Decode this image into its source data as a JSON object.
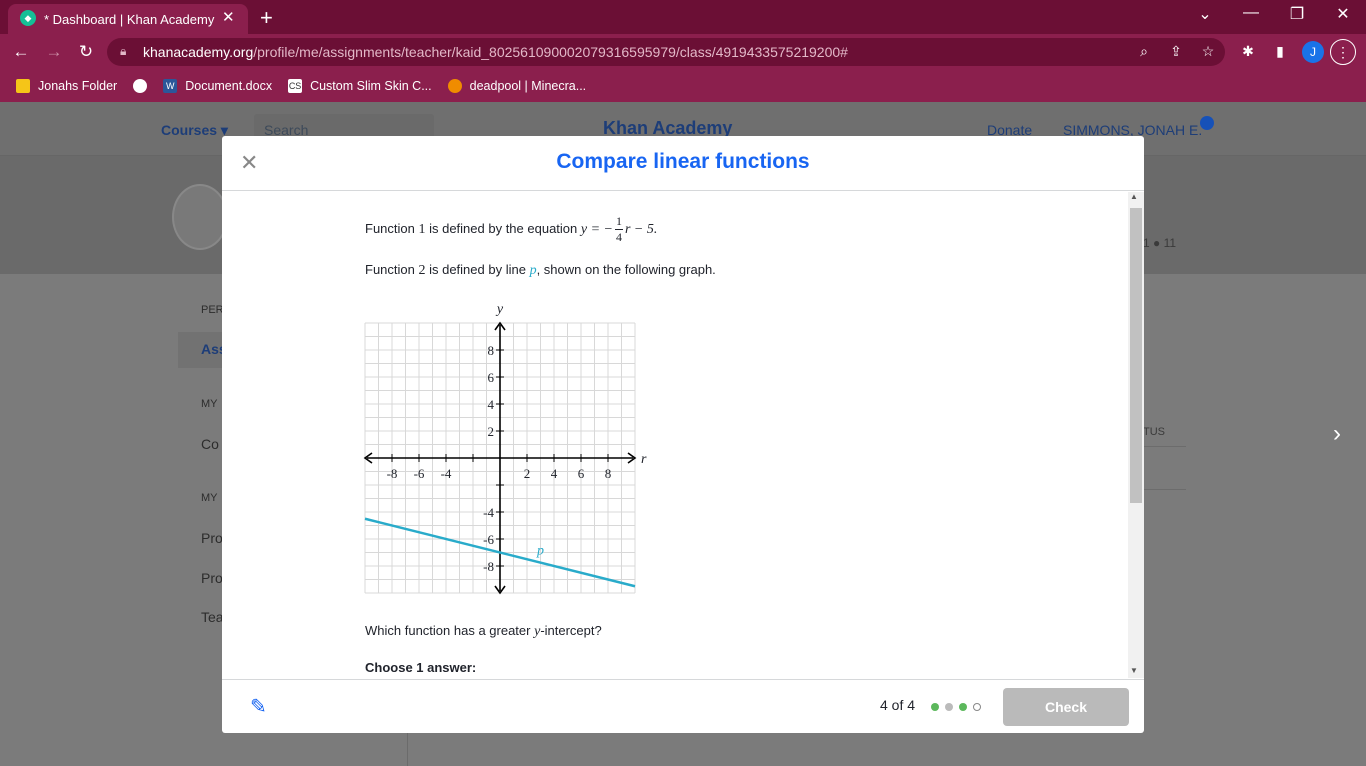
{
  "browser": {
    "tab_title": "* Dashboard | Khan Academy",
    "new_tab": "+",
    "url_host": "khanacademy.org",
    "url_path": "/profile/me/assignments/teacher/kaid_802561090002079316595979/class/4919433575219200#",
    "profile_initial": "J",
    "bookmarks": [
      "Jonahs Folder",
      "Document.docx",
      "Custom Slim Skin C...",
      "deadpool | Minecra..."
    ]
  },
  "site": {
    "courses": "Courses ▾",
    "search_placeholder": "Search",
    "logo": "Khan Academy",
    "donate": "Donate",
    "user": "SIMMONS, JONAH E.",
    "stats": "1 ● 11",
    "side_items": [
      "PER",
      "Ass",
      "MY",
      "Co",
      "MY",
      "Pro",
      "Pro",
      "Tea"
    ],
    "status_col": "TUS"
  },
  "modal": {
    "title": "Compare linear functions",
    "f1_text_pre": "Function ",
    "f1_num": "1",
    "f1_text_mid": " is defined by the equation ",
    "f1_eq_lhs": "y = −",
    "frac_num": "1",
    "frac_den": "4",
    "f1_eq_rhs": "r − 5.",
    "f2_text_pre": "Function ",
    "f2_num": "2",
    "f2_text_mid": " is defined by line ",
    "f2_line": "p",
    "f2_text_post": ", shown on the following graph.",
    "question_pre": "Which function has a greater ",
    "question_var": "y",
    "question_post": "-intercept?",
    "choose": "Choose 1 answer:",
    "progress": "4 of 4",
    "check": "Check"
  },
  "chart_data": {
    "type": "line",
    "xlabel": "r",
    "ylabel": "y",
    "xlim": [
      -10,
      10
    ],
    "ylim": [
      -10,
      10
    ],
    "xticks": [
      -8,
      -6,
      -4,
      2,
      4,
      6,
      8
    ],
    "yticks": [
      8,
      6,
      4,
      2,
      -4,
      -6,
      -8
    ],
    "grid": true,
    "series": [
      {
        "name": "p",
        "x": [
          -10,
          10
        ],
        "y": [
          -4.5,
          -9.5
        ],
        "color": "#29abca"
      }
    ]
  },
  "colors": {
    "chrome": "#8b1f4d",
    "accent": "#1865f2",
    "line": "#29abca",
    "dot_done": "#5cb85c"
  }
}
